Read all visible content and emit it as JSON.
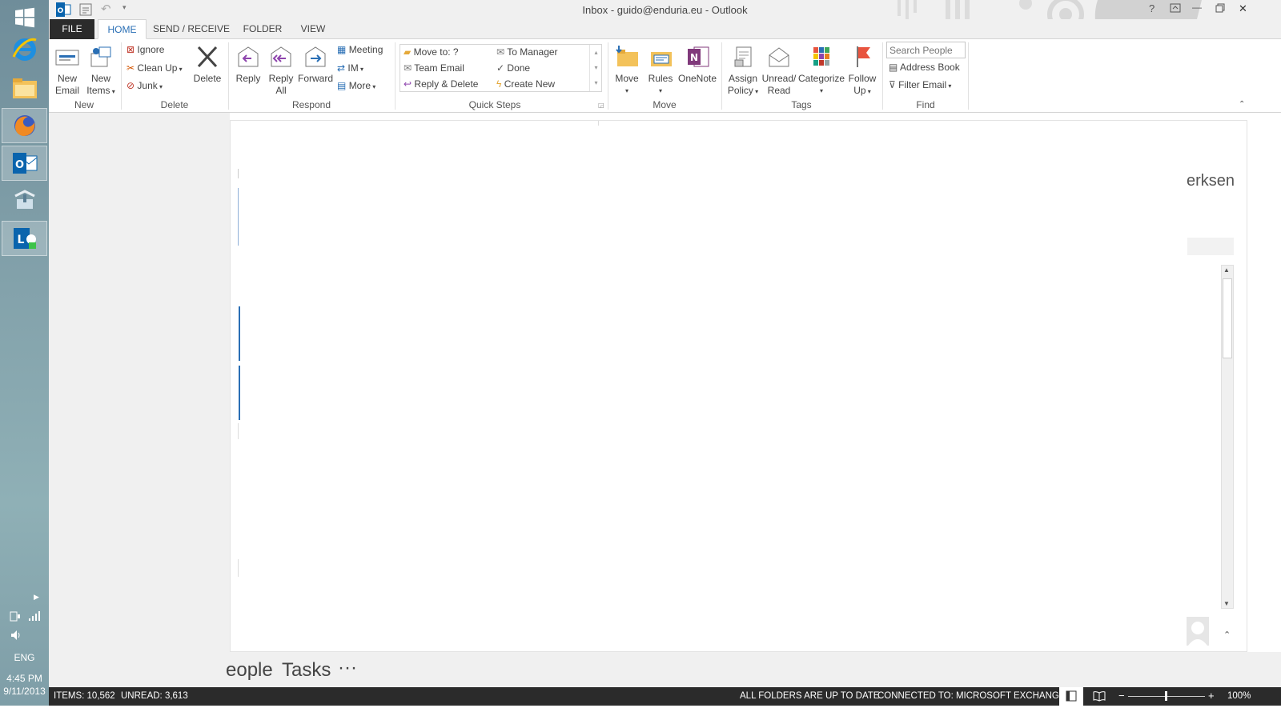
{
  "window": {
    "title": "Inbox - guido@enduria.eu - Outlook",
    "help": "?",
    "minimize": "—",
    "close": "✕"
  },
  "tabs": [
    "FILE",
    "HOME",
    "SEND / RECEIVE",
    "FOLDER",
    "VIEW"
  ],
  "ribbon": {
    "new": {
      "new_email": [
        "New",
        "Email"
      ],
      "new_items": [
        "New",
        "Items"
      ],
      "group": "New"
    },
    "delete": {
      "ignore": "Ignore",
      "clean_up": "Clean Up",
      "junk": "Junk",
      "delete": "Delete",
      "group": "Delete"
    },
    "respond": {
      "reply": "Reply",
      "reply_all": [
        "Reply",
        "All"
      ],
      "forward": "Forward",
      "meeting": "Meeting",
      "im": "IM",
      "more": "More",
      "group": "Respond"
    },
    "quick_steps": {
      "items": [
        "Move to: ?",
        "To Manager",
        "Team Email",
        "Done",
        "Reply & Delete",
        "Create New"
      ],
      "group": "Quick Steps"
    },
    "move": {
      "move": "Move",
      "rules": "Rules",
      "onenote": "OneNote",
      "group": "Move"
    },
    "tags": {
      "assign_policy": [
        "Assign",
        "Policy"
      ],
      "unread_read": [
        "Unread/",
        "Read"
      ],
      "categorize": "Categorize",
      "follow_up": [
        "Follow",
        "Up"
      ],
      "group": "Tags"
    },
    "find": {
      "search_placeholder": "Search People",
      "address_book": "Address Book",
      "filter_email": "Filter Email",
      "group": "Find"
    }
  },
  "main": {
    "partial_name": "erksen"
  },
  "bottom_nav": {
    "people": "eople",
    "tasks": "Tasks",
    "more": "···"
  },
  "taskbar": {
    "language": "ENG",
    "time": "4:45 PM",
    "date": "9/11/2013"
  },
  "status": {
    "items": "ITEMS: 10,562",
    "unread": "UNREAD: 3,613",
    "sync": "ALL FOLDERS ARE UP TO DATE.",
    "connection": "CONNECTED TO: MICROSOFT EXCHANGE",
    "zoom": "100%"
  },
  "colors": {
    "accent": "#2a6fb5",
    "status_bar": "#2b2b2b",
    "follow_flag": "#e8543f"
  }
}
